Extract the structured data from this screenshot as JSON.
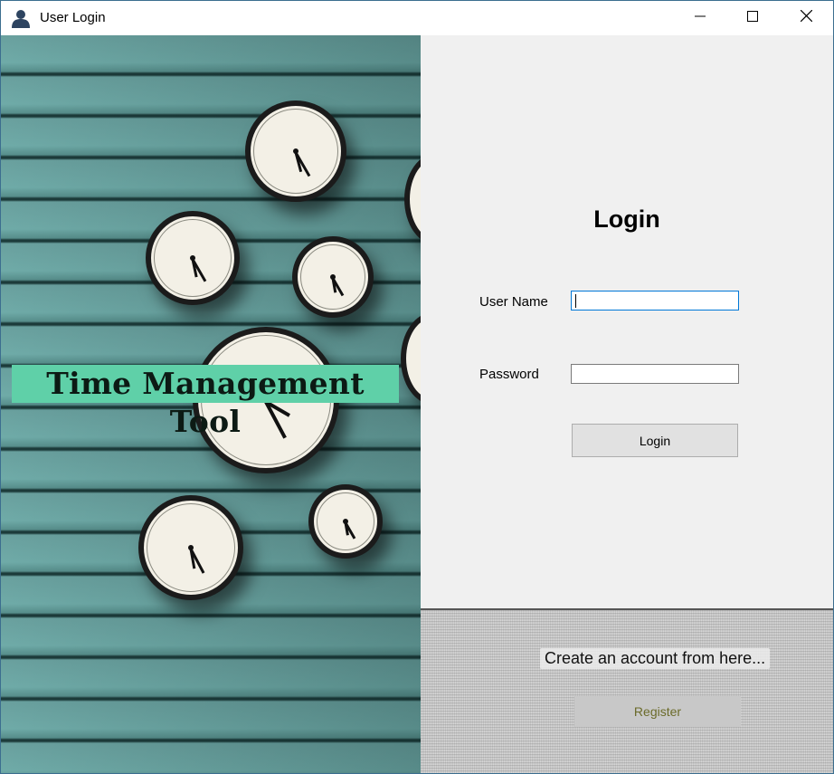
{
  "window": {
    "title": "User Login",
    "icon": "user-icon",
    "controls": [
      "minimize-icon",
      "maximize-icon",
      "close-icon"
    ]
  },
  "banner": {
    "title": "Time Management Tool"
  },
  "login": {
    "heading": "Login",
    "username_label": "User Name",
    "username_value": "",
    "password_label": "Password",
    "password_value": "",
    "login_button": "Login"
  },
  "register": {
    "prompt": "Create an account from here...",
    "register_button": "Register"
  },
  "colors": {
    "banner_bg": "#5fd0a8",
    "panel_bg": "#f0f0f0",
    "focus_border": "#0078d7",
    "register_text": "#6b6b2a"
  }
}
